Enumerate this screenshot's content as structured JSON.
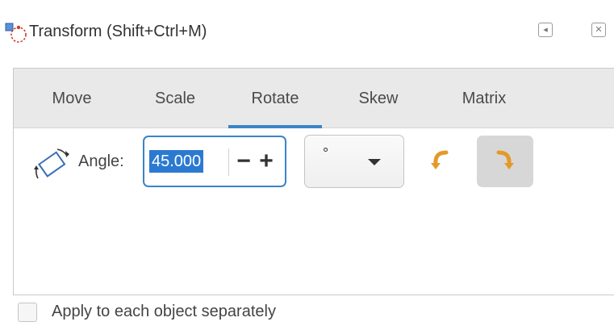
{
  "window": {
    "title": "Transform (Shift+Ctrl+M)",
    "title_icon": "transform-icon",
    "dock_icon": "dock-arrow-icon",
    "close_icon": "close-icon"
  },
  "tabs": [
    {
      "label": "Move",
      "active": false
    },
    {
      "label": "Scale",
      "active": false
    },
    {
      "label": "Rotate",
      "active": true
    },
    {
      "label": "Skew",
      "active": false
    },
    {
      "label": "Matrix",
      "active": false
    }
  ],
  "rotate": {
    "angle_icon": "rotate-object-icon",
    "angle_label": "Angle:",
    "angle_value": "45.000",
    "minus_label": "−",
    "plus_label": "+",
    "unit": "°",
    "ccw_icon": "rotate-counterclockwise-icon",
    "cw_icon": "rotate-clockwise-icon",
    "cw_selected": true
  },
  "options": {
    "apply_each_label": "Apply to each object separately",
    "apply_each_checked": false
  },
  "colors": {
    "accent": "#3b84c9",
    "selection": "#2b7ad1",
    "arrow_orange": "#e39a2b"
  }
}
